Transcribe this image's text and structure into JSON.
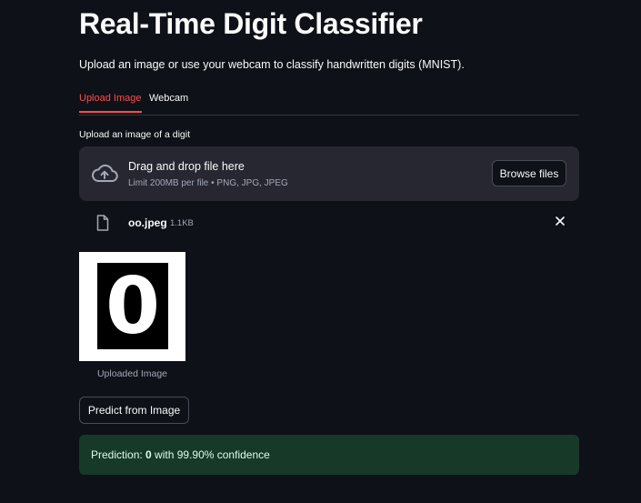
{
  "page": {
    "title": "Real-Time Digit Classifier",
    "subtitle": "Upload an image or use your webcam to classify handwritten digits (MNIST)."
  },
  "tabs": [
    {
      "label": "Upload Image",
      "active": true
    },
    {
      "label": "Webcam",
      "active": false
    }
  ],
  "uploader": {
    "label": "Upload an image of a digit",
    "drag_text": "Drag and drop file here",
    "limit_text": "Limit 200MB per file • PNG, JPG, JPEG",
    "browse_label": "Browse files",
    "icon": "cloud-upload-icon"
  },
  "file": {
    "name": "oo.jpeg",
    "size": "1.1KB",
    "icon": "file-icon",
    "remove_icon": "close-icon"
  },
  "image": {
    "digit": "0",
    "caption": "Uploaded Image"
  },
  "predict_button": "Predict from Image",
  "prediction": {
    "prefix": "Prediction: ",
    "digit": "0",
    "suffix": " with 99.90% confidence"
  },
  "colors": {
    "background": "#0e1117",
    "accent": "#ff4b4b",
    "dropzone": "#262730",
    "success_bg": "#173928",
    "success_text": "#dffde9"
  }
}
